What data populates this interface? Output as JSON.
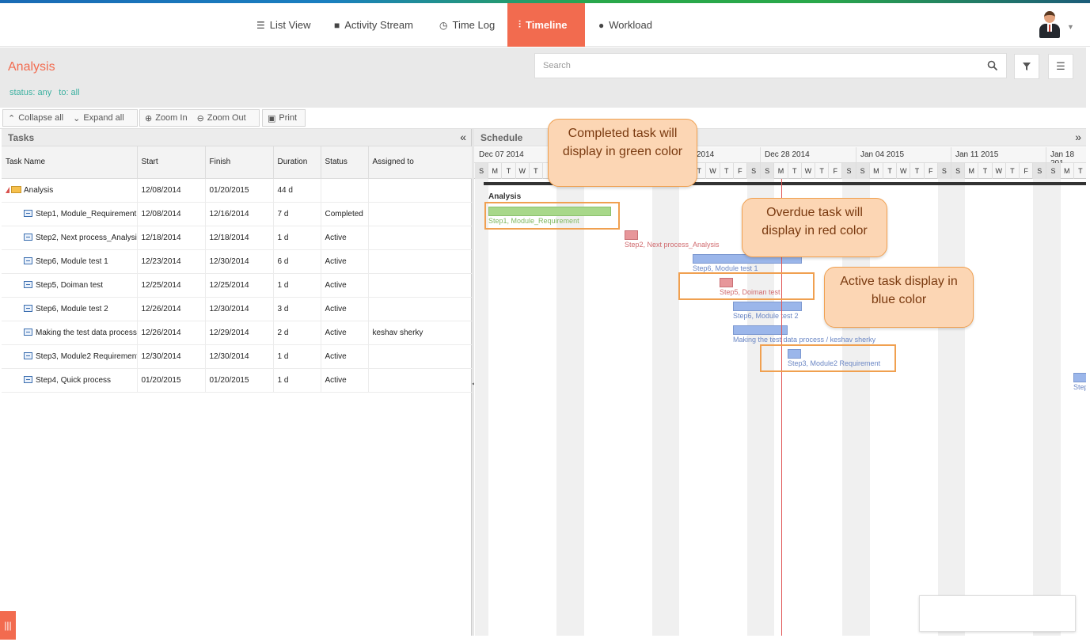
{
  "nav": {
    "items": [
      {
        "label": "List View",
        "icon": "list-icon"
      },
      {
        "label": "Activity Stream",
        "icon": "comment-icon"
      },
      {
        "label": "Time Log",
        "icon": "clock-icon"
      },
      {
        "label": "Timeline",
        "icon": "timeline-icon",
        "active": true
      },
      {
        "label": "Workload",
        "icon": "user-icon"
      }
    ]
  },
  "header": {
    "title": "Analysis",
    "filters": [
      "status: any",
      "to: all"
    ],
    "search_placeholder": "Search"
  },
  "toolbar": {
    "collapse_all": "Collapse all",
    "expand_all": "Expand all",
    "zoom_in": "Zoom In",
    "zoom_out": "Zoom Out",
    "print": "Print"
  },
  "tasks": {
    "panel_title": "Tasks",
    "columns": [
      "Task Name",
      "Start",
      "Finish",
      "Duration",
      "Status",
      "Assigned to"
    ],
    "rows": [
      {
        "name": "Analysis",
        "start": "12/08/2014",
        "finish": "01/20/2015",
        "duration": "44 d",
        "status": "",
        "assigned": "",
        "group": true
      },
      {
        "name": "Step1, Module_Requirement",
        "start": "12/08/2014",
        "finish": "12/16/2014",
        "duration": "7 d",
        "status": "Completed",
        "assigned": ""
      },
      {
        "name": "Step2, Next process_Analysi",
        "start": "12/18/2014",
        "finish": "12/18/2014",
        "duration": "1 d",
        "status": "Active",
        "assigned": ""
      },
      {
        "name": "Step6, Module test 1",
        "start": "12/23/2014",
        "finish": "12/30/2014",
        "duration": "6 d",
        "status": "Active",
        "assigned": ""
      },
      {
        "name": "Step5, Doiman test",
        "start": "12/25/2014",
        "finish": "12/25/2014",
        "duration": "1 d",
        "status": "Active",
        "assigned": ""
      },
      {
        "name": "Step6, Module test 2",
        "start": "12/26/2014",
        "finish": "12/30/2014",
        "duration": "3 d",
        "status": "Active",
        "assigned": ""
      },
      {
        "name": "Making the test data process",
        "start": "12/26/2014",
        "finish": "12/29/2014",
        "duration": "2 d",
        "status": "Active",
        "assigned": "keshav sherky"
      },
      {
        "name": "Step3, Module2 Requirement",
        "start": "12/30/2014",
        "finish": "12/30/2014",
        "duration": "1 d",
        "status": "Active",
        "assigned": ""
      },
      {
        "name": "Step4, Quick process",
        "start": "01/20/2015",
        "finish": "01/20/2015",
        "duration": "1 d",
        "status": "Active",
        "assigned": ""
      }
    ]
  },
  "schedule": {
    "panel_title": "Schedule",
    "weeks": [
      "Dec 07 2014",
      "2014",
      "Dec 28 2014",
      "Jan 04 2015",
      "Jan 11 2015",
      "Jan 18 201"
    ],
    "day_letters": [
      "S",
      "M",
      "T",
      "W",
      "T",
      "F",
      "S"
    ],
    "group_label": "Analysis",
    "bars": [
      {
        "label": "Step1, Module_Requirement",
        "status": "completed"
      },
      {
        "label": "Step2, Next process_Analysis",
        "status": "overdue"
      },
      {
        "label": "Step6, Module test 1",
        "status": "active"
      },
      {
        "label": "Step5, Doiman test",
        "status": "overdue"
      },
      {
        "label": "Step6, Module test 2",
        "status": "active"
      },
      {
        "label": "Making the test data process / keshav sherky",
        "status": "active"
      },
      {
        "label": "Step3, Module2 Requirement",
        "status": "active"
      },
      {
        "label": "Step",
        "status": "active"
      }
    ]
  },
  "callouts": {
    "completed": "Completed task will display in green color",
    "overdue": "Overdue task will display in red color",
    "active": "Active task display in blue color"
  },
  "colors": {
    "accent": "#f26b4f",
    "completed": "#a8d88a",
    "overdue": "#e7969a",
    "active": "#9bb6ea",
    "callout_bg": "#fcd6b4",
    "callout_border": "#f0a050"
  }
}
